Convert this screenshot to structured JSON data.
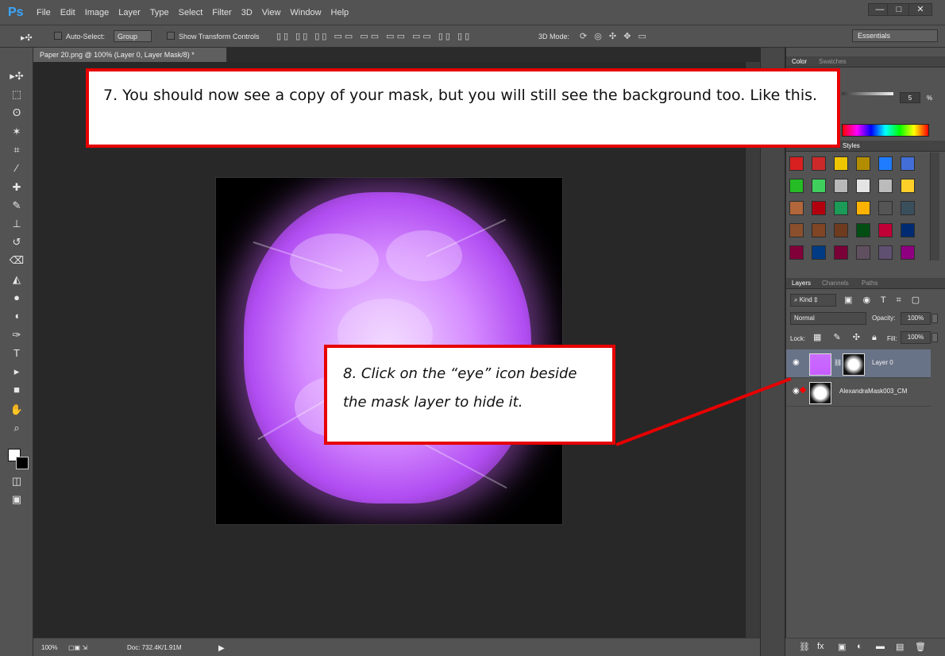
{
  "app": {
    "logo": "Ps",
    "menu": [
      "File",
      "Edit",
      "Image",
      "Layer",
      "Type",
      "Select",
      "Filter",
      "3D",
      "View",
      "Window",
      "Help"
    ],
    "window_controls": {
      "minimize": "—",
      "maximize": "□",
      "close": "✕"
    },
    "workspace": "Essentials"
  },
  "options_bar": {
    "move_icon": "move-tool-icon",
    "auto_select_label": "Auto-Select:",
    "auto_select_value": "Group",
    "show_transform_label": "Show Transform Controls",
    "mode_label": "3D Mode:"
  },
  "document": {
    "tab_title": "Paper 20.png @ 100% (Layer 0, Layer Mask/8) *",
    "zoom": "100%",
    "doc_size": "Doc: 732.4K/1.91M"
  },
  "tool_icons": [
    "move-tool-icon",
    "marquee-tool-icon",
    "lasso-tool-icon",
    "magic-wand-icon",
    "crop-tool-icon",
    "eyedropper-icon",
    "healing-brush-icon",
    "brush-tool-icon",
    "clone-stamp-icon",
    "history-brush-icon",
    "eraser-icon",
    "paint-bucket-icon",
    "blur-tool-icon",
    "dodge-tool-icon",
    "pen-tool-icon",
    "type-tool-icon",
    "path-selection-icon",
    "rectangle-tool-icon",
    "hand-tool-icon",
    "zoom-tool-icon"
  ],
  "panels": {
    "color_tabs": [
      "Color",
      "Swatches"
    ],
    "color_value": "5",
    "color_percent": "%",
    "styles_tab": "Styles",
    "layers_tabs": [
      "Layers",
      "Channels",
      "Paths"
    ],
    "kind_filter": "Kind",
    "blend_mode": "Normal",
    "opacity_label": "Opacity:",
    "opacity_value": "100%",
    "lock_label": "Lock:",
    "fill_label": "Fill:",
    "fill_value": "100%",
    "layers": [
      {
        "name": "Layer 0",
        "selected": true
      },
      {
        "name": "AlexandraMask003_CM",
        "selected": false
      }
    ]
  },
  "callouts": {
    "step7": "7.  You should now see a copy of your mask, but you will still see the background too.  Like this.",
    "step8": "8.  Click on the “eye” icon beside the mask layer to hide  it."
  },
  "colors": {
    "annotation_red": "#e60000",
    "panel_gray": "#535353",
    "canvas_dark": "#282828",
    "purple": "#d58bff"
  }
}
